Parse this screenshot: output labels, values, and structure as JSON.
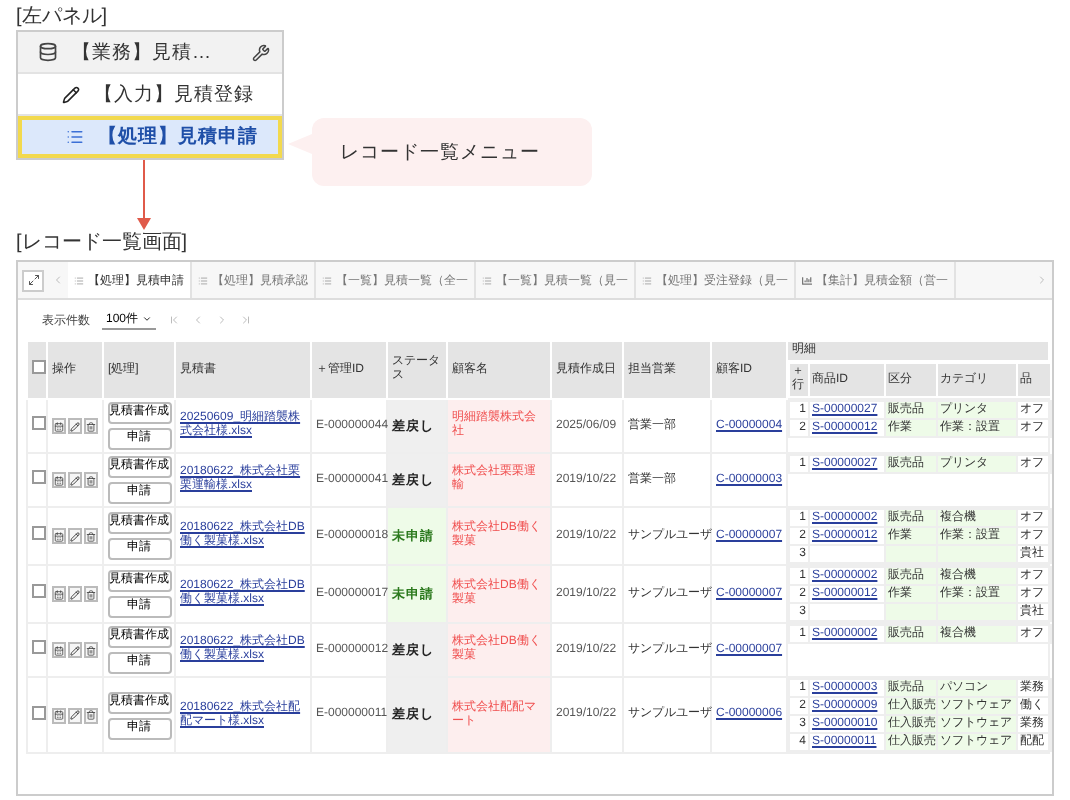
{
  "left_panel": {
    "heading": "[左パネル]",
    "items": [
      {
        "kind": "group",
        "label": "【業務】見積…",
        "selected": false
      },
      {
        "kind": "input",
        "label": "【入力】見積登録",
        "selected": false
      },
      {
        "kind": "process",
        "label": "【処理】見積申請",
        "selected": true
      }
    ]
  },
  "callout": {
    "text": "レコード一覧メニュー"
  },
  "screen_heading": "[レコード一覧画面]",
  "tabs": [
    {
      "kind": "list",
      "label": "【処理】見積申請",
      "selected": true
    },
    {
      "kind": "list",
      "label": "【処理】見積承認",
      "selected": false
    },
    {
      "kind": "list",
      "label": "【一覧】見積一覧（全一",
      "selected": false
    },
    {
      "kind": "list",
      "label": "【一覧】見積一覧（見一",
      "selected": false
    },
    {
      "kind": "list",
      "label": "【処理】受注登録（見一",
      "selected": false
    },
    {
      "kind": "chart",
      "label": "【集計】見積金額（営一",
      "selected": false
    }
  ],
  "pager": {
    "label": "表示件数",
    "page_size": "100件"
  },
  "table": {
    "select_all": false,
    "columns": [
      "操作",
      "[処理]",
      "見積書",
      "＋管理ID",
      "ステータス",
      "顧客名",
      "見積作成日",
      "担当営業",
      "顧客ID"
    ],
    "detail_heading": "明細",
    "detail_columns": [
      "＋行",
      "商品ID",
      "区分",
      "カテゴリ",
      "品"
    ],
    "rows": [
      {
        "checked": false,
        "buttons": [
          "見積書作成",
          "申請"
        ],
        "file": "20250609_明細踏襲株式会社様.xlsx",
        "id": "E-000000044",
        "status": "差戻し",
        "kind": "returned",
        "customer": "明細踏襲株式会社",
        "date": "2025/06/09",
        "owner": "営業一部",
        "customer_id": "C-00000004",
        "details": [
          {
            "no": "1",
            "product_id": "S-00000027",
            "category": "販売品",
            "type": "プリンタ",
            "item": "オフ"
          },
          {
            "no": "2",
            "product_id": "S-00000012",
            "category": "作業",
            "type": "作業：設置",
            "item": "オフ"
          }
        ]
      },
      {
        "checked": false,
        "buttons": [
          "見積書作成",
          "申請"
        ],
        "file": "20180622_株式会社栗栗運輸様.xlsx",
        "id": "E-000000041",
        "status": "差戻し",
        "kind": "returned",
        "customer": "株式会社栗栗運輸",
        "date": "2019/10/22",
        "owner": "営業一部",
        "customer_id": "C-00000003",
        "details": [
          {
            "no": "1",
            "product_id": "S-00000027",
            "category": "販売品",
            "type": "プリンタ",
            "item": "オフ"
          }
        ]
      },
      {
        "checked": false,
        "buttons": [
          "見積書作成",
          "申請"
        ],
        "file": "20180622_株式会社DB働く製菓様.xlsx",
        "id": "E-000000018",
        "status": "未申請",
        "kind": "draft",
        "customer": "株式会社DB働く製菓",
        "date": "2019/10/22",
        "owner": "サンプルユーザ",
        "customer_id": "C-00000007",
        "details": [
          {
            "no": "1",
            "product_id": "S-00000002",
            "category": "販売品",
            "type": "複合機",
            "item": "オフ"
          },
          {
            "no": "2",
            "product_id": "S-00000012",
            "category": "作業",
            "type": "作業：設置",
            "item": "オフ"
          },
          {
            "no": "3",
            "item": "貴社"
          }
        ]
      },
      {
        "checked": false,
        "buttons": [
          "見積書作成",
          "申請"
        ],
        "file": "20180622_株式会社DB働く製菓様.xlsx",
        "id": "E-000000017",
        "status": "未申請",
        "kind": "draft",
        "customer": "株式会社DB働く製菓",
        "date": "2019/10/22",
        "owner": "サンプルユーザ",
        "customer_id": "C-00000007",
        "details": [
          {
            "no": "1",
            "product_id": "S-00000002",
            "category": "販売品",
            "type": "複合機",
            "item": "オフ"
          },
          {
            "no": "2",
            "product_id": "S-00000012",
            "category": "作業",
            "type": "作業：設置",
            "item": "オフ"
          },
          {
            "no": "3",
            "item": "貴社"
          }
        ]
      },
      {
        "checked": false,
        "buttons": [
          "見積書作成",
          "申請"
        ],
        "file": "20180622_株式会社DB働く製菓様.xlsx",
        "id": "E-000000012",
        "status": "差戻し",
        "kind": "returned",
        "customer": "株式会社DB働く製菓",
        "date": "2019/10/22",
        "owner": "サンプルユーザ",
        "customer_id": "C-00000007",
        "details": [
          {
            "no": "1",
            "product_id": "S-00000002",
            "category": "販売品",
            "type": "複合機",
            "item": "オフ"
          }
        ]
      },
      {
        "checked": false,
        "buttons": [
          "見積書作成",
          "申請"
        ],
        "file": "20180622_株式会社配配マート様.xlsx",
        "id": "E-000000011",
        "status": "差戻し",
        "kind": "returned",
        "customer": "株式会社配配マート",
        "date": "2019/10/22",
        "owner": "サンプルユーザ",
        "customer_id": "C-00000006",
        "details": [
          {
            "no": "1",
            "product_id": "S-00000003",
            "category": "販売品",
            "type": "パソコン",
            "item": "業務"
          },
          {
            "no": "2",
            "product_id": "S-00000009",
            "category": "仕入販売",
            "type": "ソフトウェア",
            "item": "働く"
          },
          {
            "no": "3",
            "product_id": "S-00000010",
            "category": "仕入販売",
            "type": "ソフトウェア",
            "item": "業務"
          },
          {
            "no": "4",
            "product_id": "S-00000011",
            "category": "仕入販売",
            "type": "ソフトウェア",
            "item": "配配"
          }
        ]
      }
    ]
  }
}
